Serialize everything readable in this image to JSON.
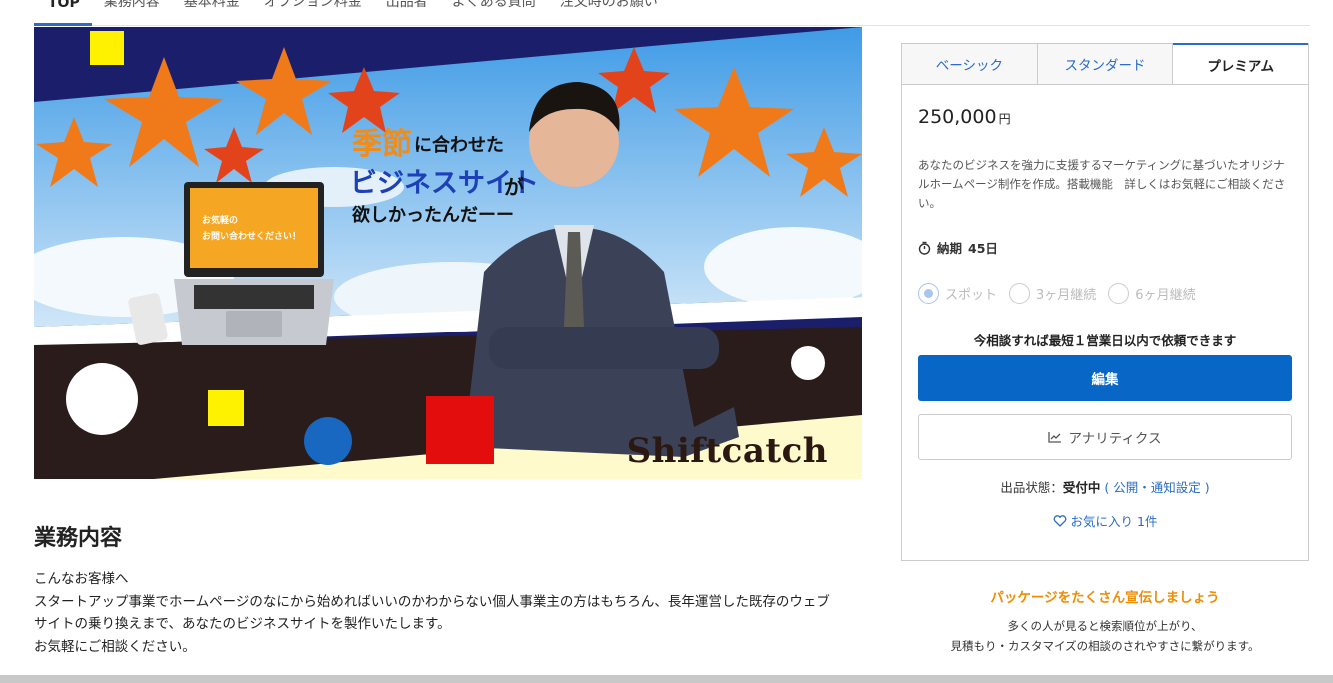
{
  "nav": {
    "items": [
      "TOP",
      "業務内容",
      "基本料金",
      "オプション料金",
      "出品者",
      "よくある質問",
      "注文時のお願い"
    ]
  },
  "hero": {
    "headline_accent": "季節",
    "headline_1": "に合わせた",
    "headline_2": "ビジネスサイト",
    "headline_2b": "が",
    "headline_3": "欲しかったんだーー",
    "laptop_line1": "お気軽の",
    "laptop_line2": "お問い合わせください！",
    "brand": "Shiftcatch"
  },
  "main": {
    "section_title": "業務内容",
    "body_lines": [
      "こんなお客様へ",
      "スタートアップ事業でホームページのなにから始めればいいのかわからない個人事業主の方はもちろん、長年運営した既存のウェブ",
      "サイトの乗り換えまで、あなたのビジネスサイトを製作いたします。",
      "お気軽にご相談ください。"
    ]
  },
  "plan": {
    "tabs": [
      "ベーシック",
      "スタンダード",
      "プレミアム"
    ],
    "active_tab": 2,
    "price": "250,000",
    "price_unit": "円",
    "description": "あなたのビジネスを強力に支援するマーケティングに基づいたオリジナルホームページ制作を作成。搭載機能　詳しくはお気軽にご相談ください。",
    "delivery_label": "納期",
    "delivery_value": "45日",
    "options": [
      "スポット",
      "3ヶ月継続",
      "6ヶ月継続"
    ],
    "consult_text": "今相談すれば最短１営業日以内で依頼できます",
    "edit_label": "編集",
    "analytics_label": "アナリティクス",
    "status_label": "出品状態：",
    "status_value": "受付中",
    "status_paren_open": " ( ",
    "status_link": "公開・通知設定",
    "status_paren_close": " )",
    "favorite_label": "お気に入り",
    "favorite_count": "1件"
  },
  "promo": {
    "title": "パッケージをたくさん宣伝しましょう",
    "line1": "多くの人が見ると検索順位が上がり、",
    "line2": "見積もり・カスタマイズの相談のされやすさに繋がります。"
  },
  "colors": {
    "primary": "#0866c6",
    "link": "#2a6cc7",
    "promo": "#f08c00",
    "navy": "#1b1f6b"
  }
}
